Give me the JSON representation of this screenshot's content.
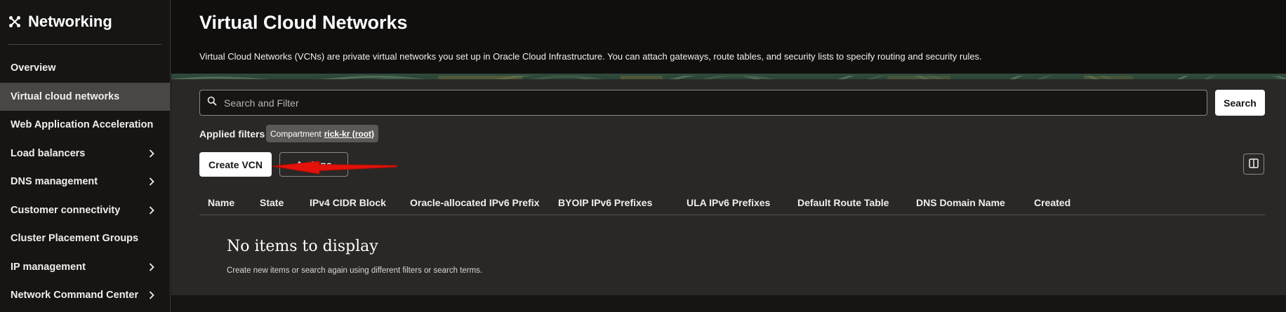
{
  "sidebar": {
    "title": "Networking",
    "items": [
      {
        "label": "Overview",
        "has_submenu": false
      },
      {
        "label": "Virtual cloud networks",
        "has_submenu": false,
        "active": true
      },
      {
        "label": "Web Application Acceleration",
        "has_submenu": false
      },
      {
        "label": "Load balancers",
        "has_submenu": true
      },
      {
        "label": "DNS management",
        "has_submenu": true
      },
      {
        "label": "Customer connectivity",
        "has_submenu": true
      },
      {
        "label": "Cluster Placement Groups",
        "has_submenu": false
      },
      {
        "label": "IP management",
        "has_submenu": true
      },
      {
        "label": "Network Command Center",
        "has_submenu": true
      }
    ]
  },
  "header": {
    "title": "Virtual Cloud Networks",
    "description": "Virtual Cloud Networks (VCNs) are private virtual networks you set up in Oracle Cloud Infrastructure. You can attach gateways, route tables, and security lists to specify routing and security rules."
  },
  "search": {
    "placeholder": "Search and Filter",
    "value": "",
    "button_label": "Search"
  },
  "filters": {
    "label": "Applied filters",
    "chip_key": "Compartment",
    "chip_value": "rick-kr (root)"
  },
  "toolbar": {
    "create_label": "Create VCN",
    "actions_label": "Actions"
  },
  "table": {
    "columns": [
      "Name",
      "State",
      "IPv4 CIDR Block",
      "Oracle-allocated IPv6 Prefix",
      "BYOIP IPv6 Prefixes",
      "ULA IPv6 Prefixes",
      "Default Route Table",
      "DNS Domain Name",
      "Created"
    ],
    "empty_title": "No items to display",
    "empty_subtitle": "Create new items or search again using different filters or search terms."
  },
  "colors": {
    "background": "#161513",
    "content_bg": "#2a2826",
    "active_item": "#4a4643",
    "annotation_arrow": "#e3120b"
  },
  "icons": {
    "app": "networking-icon",
    "search": "search-icon",
    "chevron": "chevron-right-icon",
    "columns": "columns-icon"
  }
}
